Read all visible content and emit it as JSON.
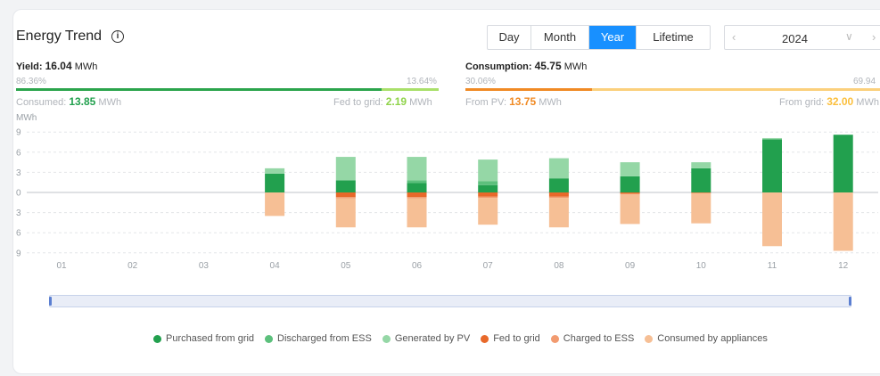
{
  "header": {
    "title": "Energy Trend",
    "info_icon": "info-icon"
  },
  "periods": {
    "items": [
      "Day",
      "Month",
      "Year",
      "Lifetime"
    ],
    "active": "Year"
  },
  "date": {
    "year": "2024",
    "prev_icon": "chevron-left-icon",
    "dropdown_icon": "chevron-down-icon",
    "next_icon": "chevron-right-icon"
  },
  "yield": {
    "label": "Yield:",
    "value": "16.04",
    "unit": "MWh",
    "pct_left": "86.36%",
    "pct_right": "13.64%",
    "consumed_label": "Consumed:",
    "consumed_value": "13.85",
    "consumed_unit": "MWh",
    "fed_label": "Fed to grid:",
    "fed_value": "2.19",
    "fed_unit": "MWh",
    "colors": {
      "left": "#2ba44c",
      "right": "#a9e06a"
    }
  },
  "consumption": {
    "label": "Consumption:",
    "value": "45.75",
    "unit": "MWh",
    "pct_left": "30.06%",
    "pct_right": "69.94",
    "pv_label": "From PV:",
    "pv_value": "13.75",
    "pv_unit": "MWh",
    "grid_label": "From grid:",
    "grid_value": "32.00",
    "grid_unit": "MWh",
    "colors": {
      "left": "#f08a24",
      "right": "#fbd07c"
    }
  },
  "chart_data": {
    "type": "bar",
    "ylabel": "MWh",
    "ytick_labels": [
      "9",
      "6",
      "3",
      "0",
      "3",
      "6",
      "9"
    ],
    "ylim": [
      -9,
      9
    ],
    "categories": [
      "01",
      "02",
      "03",
      "04",
      "05",
      "06",
      "07",
      "08",
      "09",
      "10",
      "11",
      "12"
    ],
    "positive_series": [
      {
        "name": "Purchased from grid",
        "color": "#22a04e",
        "values": [
          0,
          0,
          0,
          2.8,
          1.8,
          1.4,
          1.1,
          2.1,
          2.4,
          3.6,
          7.9,
          8.6
        ]
      },
      {
        "name": "Discharged from ESS",
        "color": "#5cc07c",
        "values": [
          0,
          0,
          0,
          0,
          0,
          0.4,
          0.6,
          0,
          0,
          0,
          0,
          0
        ]
      },
      {
        "name": "Generated by PV",
        "color": "#95d7a6",
        "values": [
          0,
          0,
          0,
          0.8,
          3.5,
          3.5,
          3.2,
          3.0,
          2.1,
          0.9,
          0.2,
          0
        ]
      }
    ],
    "negative_series": [
      {
        "name": "Fed to grid",
        "color": "#e8692a",
        "values": [
          0,
          0,
          0,
          0,
          0.7,
          0.7,
          0.6,
          0.6,
          0.2,
          0.1,
          0,
          0
        ]
      },
      {
        "name": "Charged to ESS",
        "color": "#f29b70",
        "values": [
          0,
          0,
          0,
          0,
          0.2,
          0.2,
          0.2,
          0.2,
          0,
          0,
          0,
          0
        ]
      },
      {
        "name": "Consumed by appliances",
        "color": "#f6bf95",
        "values": [
          0,
          0,
          0,
          3.5,
          4.3,
          4.3,
          4.0,
          4.4,
          4.5,
          4.5,
          8.0,
          8.7
        ]
      }
    ],
    "grid": true,
    "legend_position": "bottom"
  },
  "legend": {
    "items": [
      {
        "label": "Purchased from grid",
        "color": "#22a04e"
      },
      {
        "label": "Discharged from ESS",
        "color": "#5cc07c"
      },
      {
        "label": "Generated by PV",
        "color": "#95d7a6"
      },
      {
        "label": "Fed to grid",
        "color": "#e8692a"
      },
      {
        "label": "Charged to ESS",
        "color": "#f29b70"
      },
      {
        "label": "Consumed by appliances",
        "color": "#f6bf95"
      }
    ]
  }
}
